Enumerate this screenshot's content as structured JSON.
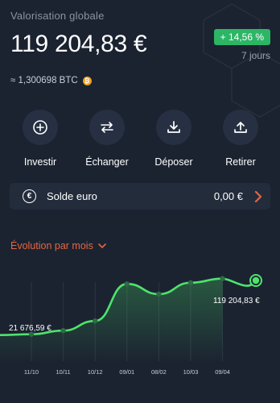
{
  "header": {
    "title": "Valorisation globale",
    "total_value": "119 204,83 €",
    "btc_equiv": "≈ 1,300698 BTC",
    "change_badge": "+ 14,56 %",
    "period": "7 jours"
  },
  "actions": [
    {
      "label": "Investir",
      "icon": "plus-circle-icon"
    },
    {
      "label": "Échanger",
      "icon": "swap-arrows-icon"
    },
    {
      "label": "Déposer",
      "icon": "download-icon"
    },
    {
      "label": "Retirer",
      "icon": "upload-icon"
    }
  ],
  "solde": {
    "label": "Solde euro",
    "value": "0,00 €"
  },
  "evolution": {
    "label": "Évolution par mois"
  },
  "colors": {
    "background": "#1b2331",
    "positive": "#2db566",
    "line": "#4ee46b",
    "accent": "#e8643f",
    "btc": "#f5a11b"
  },
  "chart_data": {
    "type": "area",
    "categories": [
      "11/10",
      "10/11",
      "10/12",
      "09/01",
      "08/02",
      "10/03",
      "09/04"
    ],
    "values": [
      21676.59,
      28000,
      45000,
      110000,
      92000,
      112000,
      119204.83
    ],
    "start_label": "21 676,59 €",
    "end_label": "119 204,83 €",
    "ylim": [
      0,
      130000
    ],
    "grid": false
  }
}
